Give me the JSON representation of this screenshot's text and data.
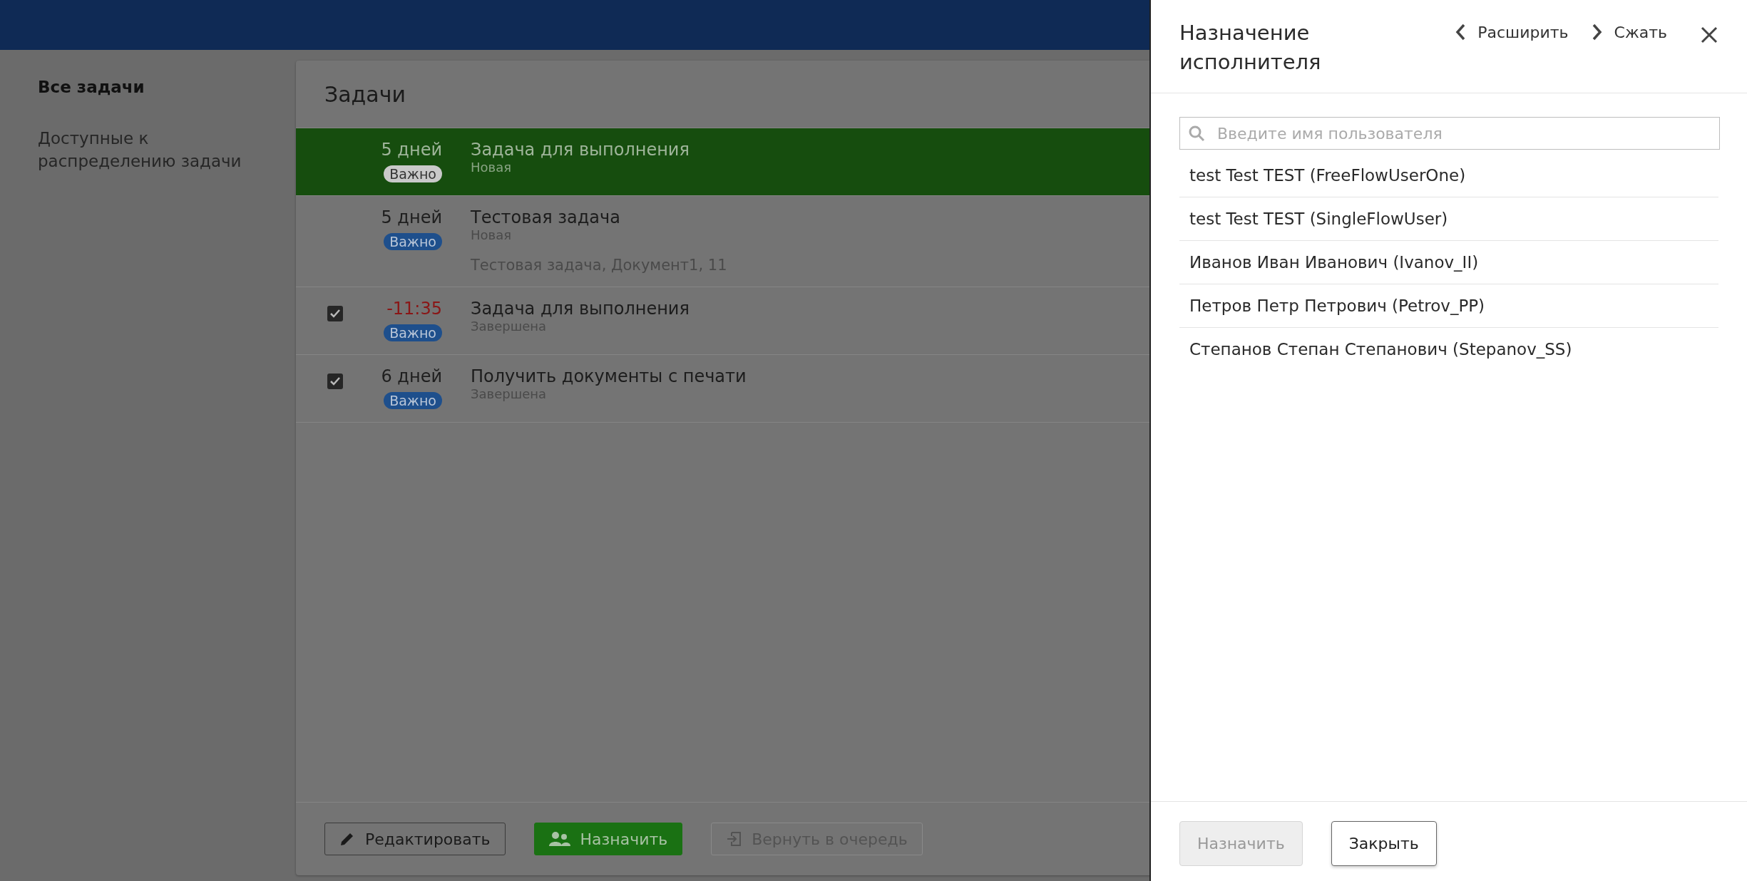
{
  "sidebar": {
    "items": [
      {
        "label": "Все задачи",
        "selected": true
      },
      {
        "label": "Доступные к распределению задачи",
        "selected": false
      }
    ]
  },
  "tasks": {
    "title": "Задачи",
    "rows": [
      {
        "due": "5 дней",
        "overdue": false,
        "badge": "Важно",
        "title": "Задача для выполнения",
        "status": "Новая",
        "checked": false,
        "selected": true
      },
      {
        "due": "5 дней",
        "overdue": false,
        "badge": "Важно",
        "title": "Тестовая задача",
        "status": "Новая",
        "details": "Тестовая задача, Документ1, 11",
        "checked": false,
        "selected": false
      },
      {
        "due": "-11:35",
        "overdue": true,
        "badge": "Важно",
        "title": "Задача для выполнения",
        "status": "Завершена",
        "checked": true,
        "selected": false
      },
      {
        "due": "6 дней",
        "overdue": false,
        "badge": "Важно",
        "title": "Получить документы с печати",
        "status": "Завершена",
        "checked": true,
        "selected": false
      }
    ],
    "buttons": [
      {
        "kind": "edit",
        "label": "Редактировать",
        "disabled": false
      },
      {
        "kind": "assign",
        "label": "Назначить",
        "disabled": false
      },
      {
        "kind": "return",
        "label": "Вернуть в очередь",
        "disabled": true
      }
    ]
  },
  "panel": {
    "title": "Назначение исполнителя",
    "actions": [
      {
        "kind": "expand",
        "label": "Расширить"
      },
      {
        "kind": "collapse",
        "label": "Сжать"
      }
    ],
    "search": {
      "placeholder": "Введите имя пользователя"
    },
    "users": [
      "test Test TEST (FreeFlowUserOne)",
      "test Test TEST (SingleFlowUser)",
      "Иванов Иван Иванович (Ivanov_II)",
      "Петров Петр Петрович (Petrov_PP)",
      "Степанов Степан Степанович (Stepanov_SS)"
    ],
    "buttons": [
      {
        "kind": "primary",
        "label": "Назначить",
        "disabled": true
      },
      {
        "kind": "secondary",
        "label": "Закрыть",
        "disabled": false
      }
    ]
  }
}
